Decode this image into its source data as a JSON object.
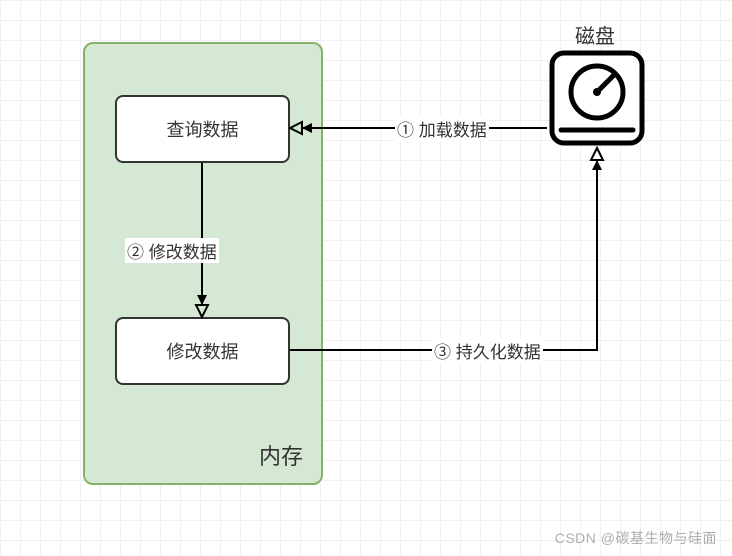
{
  "memory": {
    "label": "内存",
    "boxes": {
      "query": "查询数据",
      "modify": "修改数据"
    }
  },
  "disk": {
    "label": "磁盘"
  },
  "arrows": {
    "load": "① 加载数据",
    "modify": "② 修改数据",
    "persist": "③ 持久化数据"
  },
  "watermark": "CSDN @碳基生物与硅面"
}
